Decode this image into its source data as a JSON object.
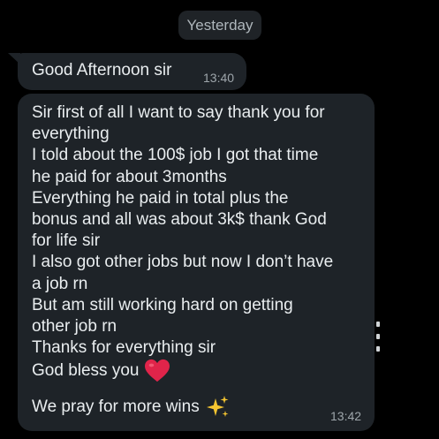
{
  "date_separator": "Yesterday",
  "messages": [
    {
      "text": "Good Afternoon sir",
      "time": "13:40"
    },
    {
      "lines": [
        "Sir first of all I want to say thank you for",
        "everything",
        "I told about the 100$ job I got that time",
        "he paid for about 3months",
        "Everything he paid in total plus the",
        "bonus and all was about 3k$ thank God",
        "for life sir",
        "I also got other jobs but now I don’t have",
        "a job rn",
        "But am still working hard on getting",
        "other job rn",
        "Thanks for everything sir"
      ],
      "emoji_lines": [
        {
          "text": "God bless you",
          "emoji": "heart-icon"
        },
        {
          "text": "We pray for more wins",
          "emoji": "sparkles-icon"
        }
      ],
      "time": "13:42"
    }
  ],
  "colors": {
    "background": "#000000",
    "bubble": "#1e2328",
    "text": "#e9edef",
    "timestamp": "#9ea6ab",
    "heart": "#e0244a",
    "sparkles": "#f5c531"
  }
}
